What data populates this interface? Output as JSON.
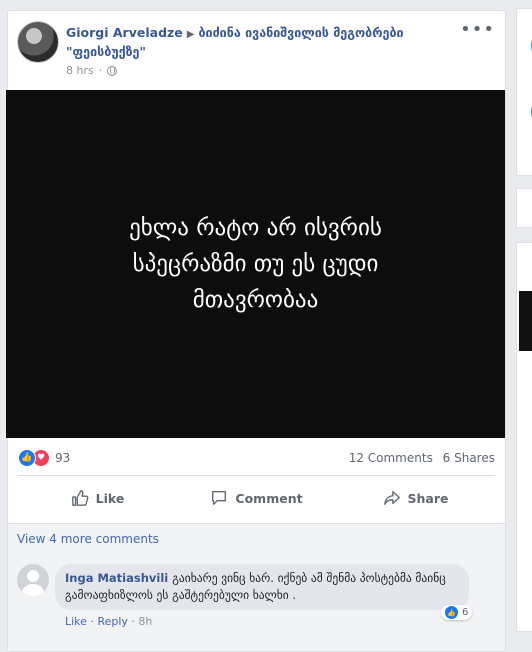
{
  "post": {
    "author": "Giorgi Arveladze",
    "group": "ბიძინა ივანიშვილის მეგობრები \"ფეისბუქზე\"",
    "time": "8 hrs",
    "more_label": "•••",
    "image_text": "ეხლა რატო არ ისვრის\nსპეცრაზმი თუ ეს ცუდი\nმთავრობაა",
    "reactions_count": "93",
    "comments_count": "12 Comments",
    "shares_count": "6 Shares",
    "actions": {
      "like": "Like",
      "comment": "Comment",
      "share": "Share"
    }
  },
  "comments": {
    "view_more": "View 4 more comments",
    "items": [
      {
        "author": "Inga Matiashvili",
        "text": "გაიხარე ვინც ხარ. იქნებ ამ შენმა პოსტებმა მაინც გამოაფხიზლოს ეს გაშტერებული ხალხი .",
        "like": "Like",
        "reply": "Reply",
        "time": "8h",
        "like_count": "6"
      }
    ]
  },
  "colors": {
    "link": "#365899",
    "like": "#1877f2",
    "love": "#f33e58",
    "image_bg": "#0d0d0d"
  }
}
